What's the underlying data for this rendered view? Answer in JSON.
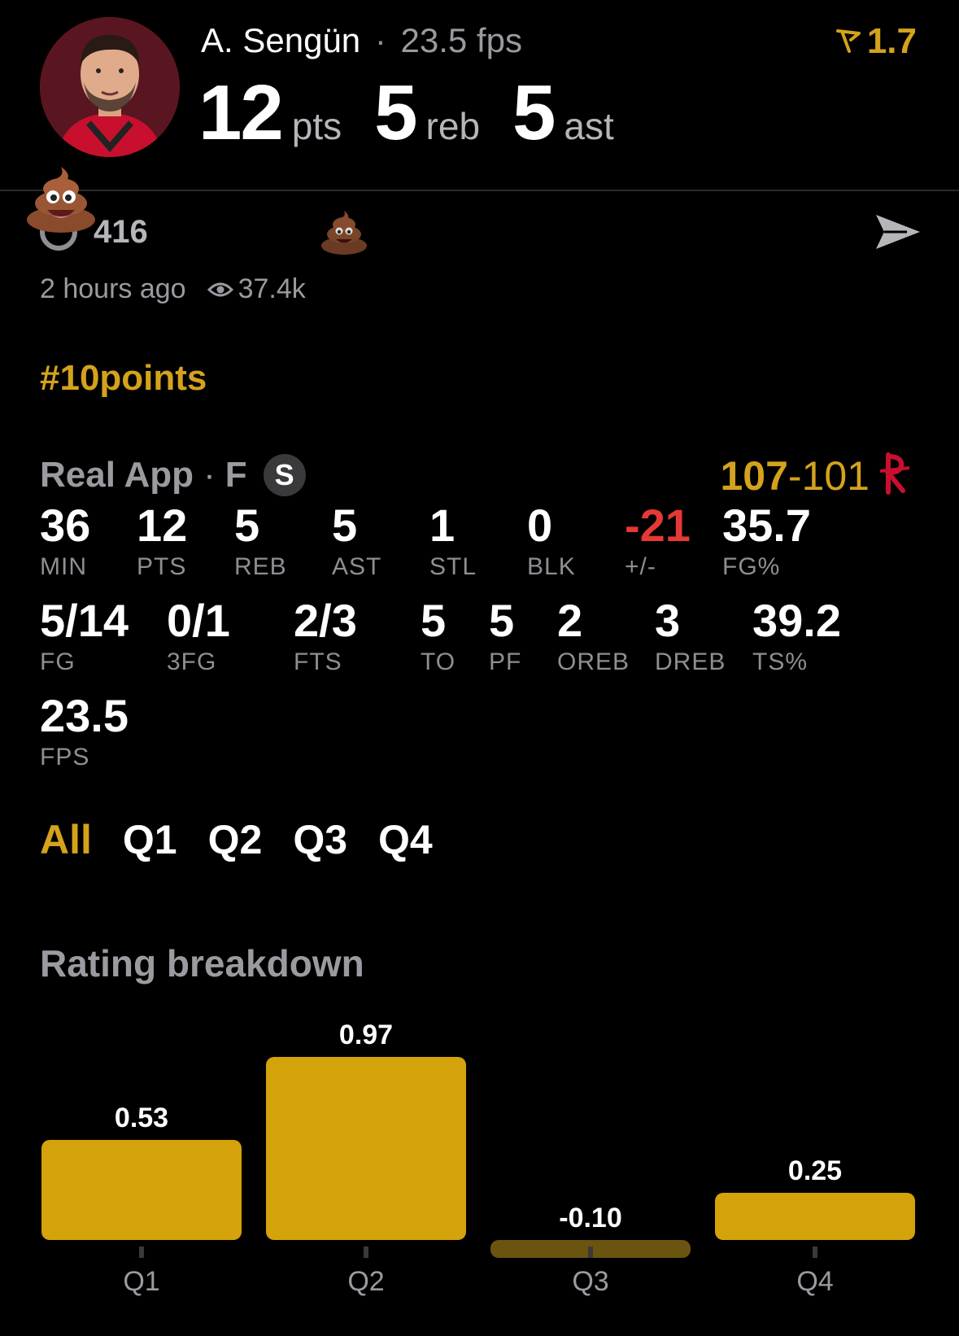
{
  "header": {
    "player_name": "A. Sengün",
    "separator": "·",
    "fps_label": "23.5 fps",
    "rating": "1.7",
    "headline": [
      {
        "value": "12",
        "unit": "pts"
      },
      {
        "value": "5",
        "unit": "reb"
      },
      {
        "value": "5",
        "unit": "ast"
      }
    ]
  },
  "reactions": {
    "count": "416",
    "posted": "2 hours ago",
    "views": "37.4k"
  },
  "hashtag": "#10points",
  "game": {
    "source": "Real App",
    "separator": "·",
    "position": "F",
    "badge": "S",
    "score_team": "107",
    "score_dash": "-",
    "score_opp": "101"
  },
  "stats_row1": [
    {
      "value": "36",
      "label": "MIN"
    },
    {
      "value": "12",
      "label": "PTS"
    },
    {
      "value": "5",
      "label": "REB"
    },
    {
      "value": "5",
      "label": "AST"
    },
    {
      "value": "1",
      "label": "STL"
    },
    {
      "value": "0",
      "label": "BLK"
    },
    {
      "value": "-21",
      "label": "+/-"
    },
    {
      "value": "35.7",
      "label": "FG%"
    }
  ],
  "stats_row2": [
    {
      "value": "5/14",
      "label": "FG"
    },
    {
      "value": "0/1",
      "label": "3FG"
    },
    {
      "value": "2/3",
      "label": "FTS"
    },
    {
      "value": "5",
      "label": "TO"
    },
    {
      "value": "5",
      "label": "PF"
    },
    {
      "value": "2",
      "label": "OREB"
    },
    {
      "value": "3",
      "label": "DREB"
    },
    {
      "value": "39.2",
      "label": "TS%"
    }
  ],
  "stats_row3": [
    {
      "value": "23.5",
      "label": "FPS"
    }
  ],
  "quarter_tabs": [
    "All",
    "Q1",
    "Q2",
    "Q3",
    "Q4"
  ],
  "rating_breakdown_title": "Rating breakdown",
  "colors": {
    "accent": "#d4a21c",
    "bar": "#d4a20a",
    "negative": "#e53935"
  },
  "chart_data": {
    "type": "bar",
    "categories": [
      "Q1",
      "Q2",
      "Q3",
      "Q4"
    ],
    "values": [
      0.53,
      0.97,
      -0.1,
      0.25
    ],
    "value_labels": [
      "0.53",
      "0.97",
      "-0.10",
      "0.25"
    ]
  }
}
